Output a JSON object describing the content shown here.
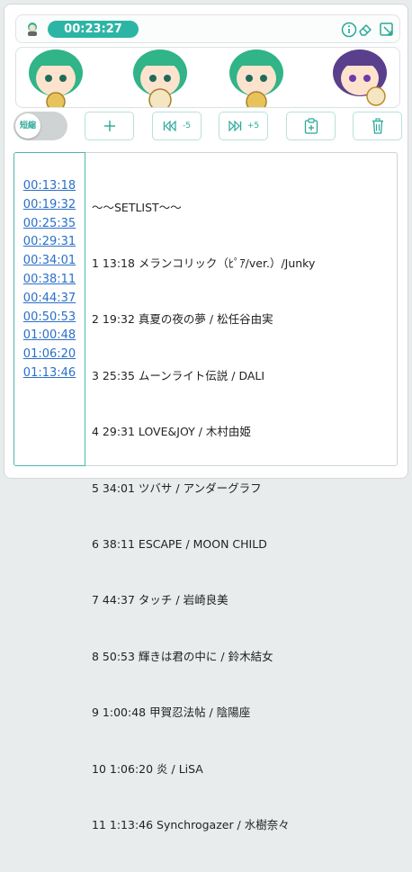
{
  "app": {
    "timer": "00:23:27",
    "toggle_label": "短縮"
  },
  "toolbar": {
    "add_icon": "plus-icon",
    "back_label": "-5",
    "forward_label": "+5",
    "paste_icon": "clipboard-add-icon",
    "delete_icon": "trash-icon"
  },
  "top_icons": [
    "info-icon",
    "eraser-icon",
    "external-link-icon"
  ],
  "colors": {
    "accent": "#2cb5a5",
    "link": "#2a6fc9"
  },
  "timestamps": [
    "00:13:18",
    "00:19:32",
    "00:25:35",
    "00:29:31",
    "00:34:01",
    "00:38:11",
    "00:44:37",
    "00:50:53",
    "01:00:48",
    "01:06:20",
    "01:13:46"
  ],
  "setlist": {
    "header": "～～SETLIST～～",
    "lines": [
      "1 13:18 メランコリック（ﾋﾟｱ/ver.）/Junky",
      "2 19:32 真夏の夜の夢 / 松任谷由実",
      "3 25:35 ムーンライト伝説 / DALI",
      "4 29:31 LOVE&JOY / 木村由姫",
      "5 34:01 ツバサ / アンダーグラフ",
      "6 38:11 ESCAPE / MOON CHILD",
      "7 44:37 タッチ / 岩崎良美",
      "8 50:53 輝きは君の中に / 鈴木結女",
      "9 1:00:48 甲賀忍法帖 / 陰陽座",
      "10 1:06:20 炎 / LiSA",
      "11 1:13:46 Synchrogazer / 水樹奈々"
    ]
  }
}
